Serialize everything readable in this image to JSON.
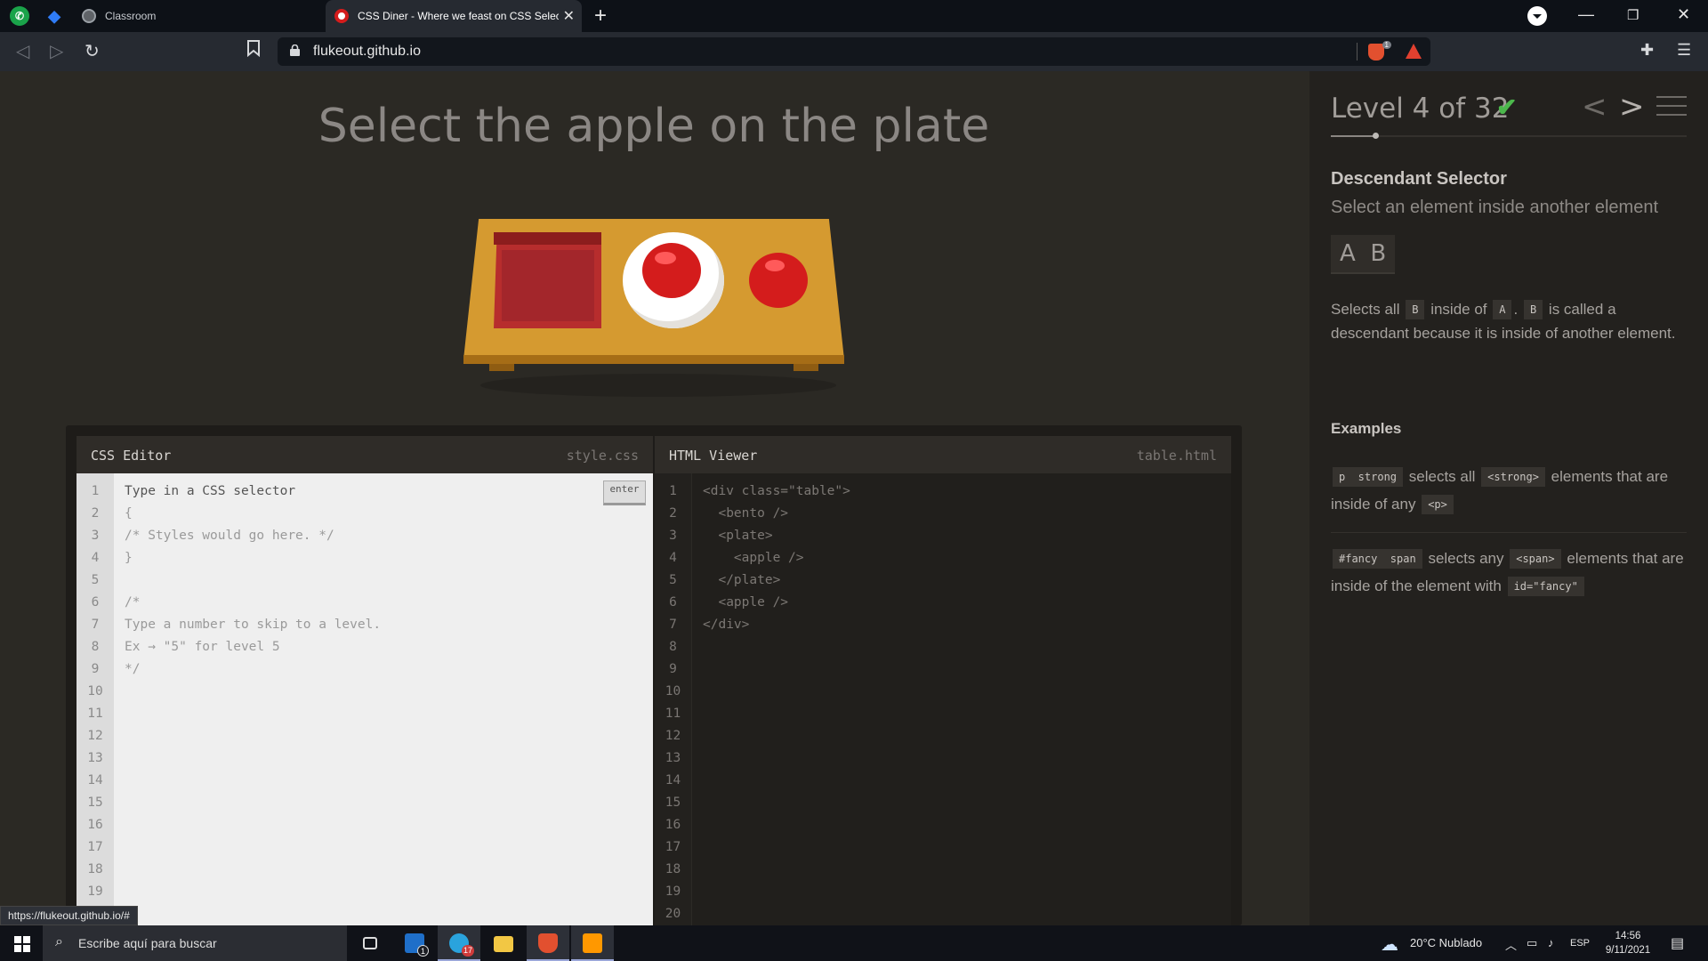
{
  "browser": {
    "tabs": [
      {
        "label": "Classroom",
        "active": false
      },
      {
        "label": "CSS Diner - Where we feast on CSS Selectors!",
        "active": true
      }
    ],
    "url": "flukeout.github.io",
    "shield_count": "1",
    "status_url": "https://flukeout.github.io/#"
  },
  "game": {
    "instruction": "Select the apple on the plate",
    "level_label": "Level 4 of 32",
    "progress": 0.125,
    "selector_name": "Descendant Selector",
    "selector_title": "Select an element inside another element",
    "syntax": "A  B",
    "desc_1": "Selects all",
    "desc_chip_b": "B",
    "desc_2": "inside of",
    "desc_chip_a": "A",
    "desc_3": ".",
    "desc_4": "is called a descendant because it is inside of another element.",
    "examples_heading": "Examples",
    "example_1": {
      "chip": "p  strong",
      "t1": "selects all",
      "chip2": "<strong>",
      "t2": "elements that are inside of any",
      "chip3": "<p>"
    },
    "example_2": {
      "chip": "#fancy  span",
      "t1": "selects any",
      "chip2": "<span>",
      "t2": "elements that are inside of the element with",
      "chip3": "id=\"fancy\""
    }
  },
  "css_editor": {
    "title": "CSS Editor",
    "filename": "style.css",
    "enter_label": "enter",
    "line_numbers": "1\n2\n3\n4\n5\n6\n7\n8\n9\n10\n11\n12\n13\n14\n15\n16\n17\n18\n19",
    "first_line": "Type in a CSS selector",
    "rest": "{\n/* Styles would go here. */\n}\n\n/*\nType a number to skip to a level.\nEx → \"5\" for level 5\n*/"
  },
  "html_viewer": {
    "title": "HTML Viewer",
    "filename": "table.html",
    "line_numbers": "1\n2\n3\n4\n5\n6\n7\n8\n9\n10\n11\n12\n13\n14\n15\n16\n17\n18\n19\n20",
    "code": "<div class=\"table\">\n  <bento />\n  <plate>\n    <apple />\n  </plate>\n  <apple />\n</div>"
  },
  "taskbar": {
    "search_placeholder": "Escribe aquí para buscar",
    "mail_badge": "1",
    "telegram_badge": "17",
    "weather": "20°C  Nublado",
    "language": "ESP",
    "time": "14:56",
    "date": "9/11/2021"
  },
  "icons": {
    "lock": "lock-icon",
    "bookmark": "bookmark-icon",
    "extensions": "puzzle-icon",
    "menu": "hamburger-icon",
    "check": "checkmark-icon",
    "start": "windows-logo-icon"
  },
  "colors": {
    "page_bg": "#2b2924",
    "sidebar_bg": "#23211e",
    "table": "#d59a30",
    "apple": "#d41c1c",
    "bento": "#b72d2d",
    "check": "#4cb84c"
  }
}
